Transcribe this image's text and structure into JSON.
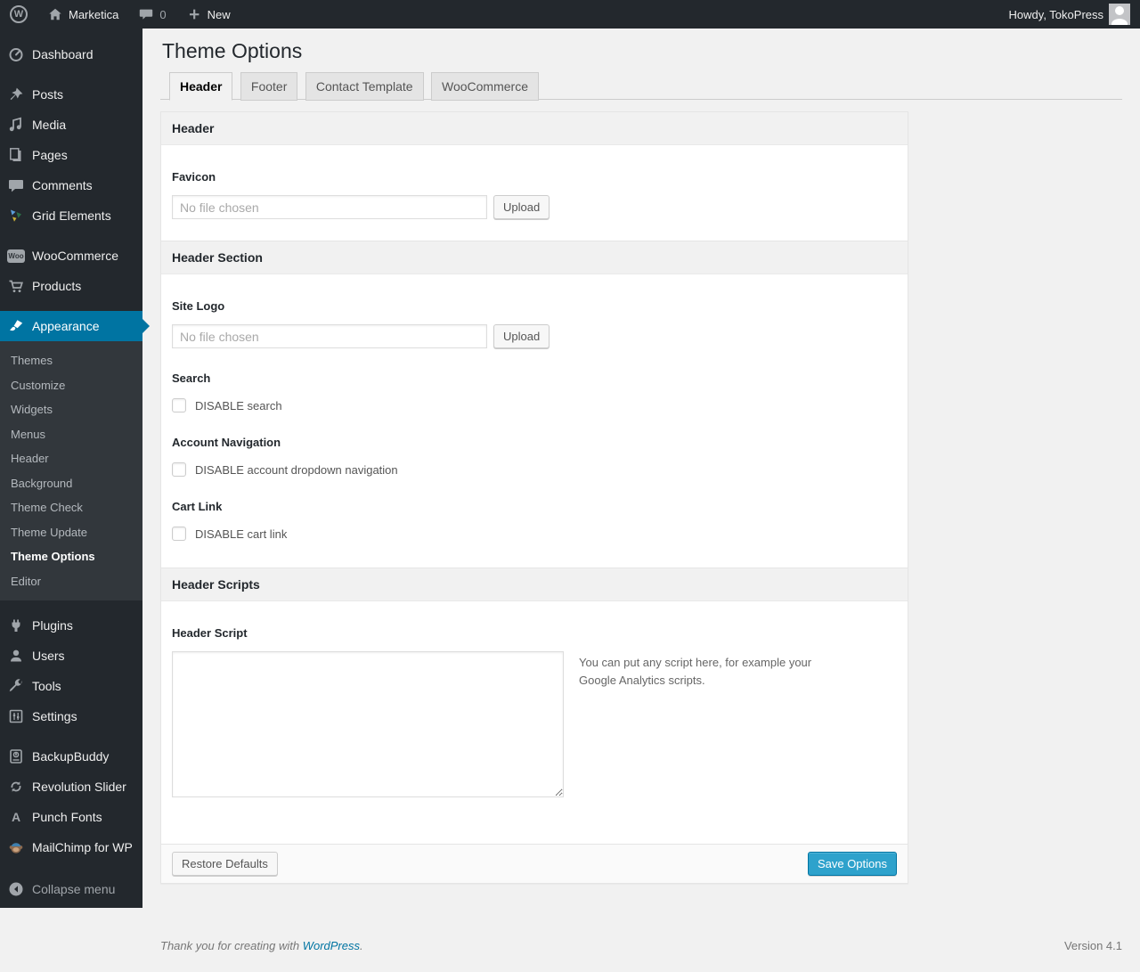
{
  "admin_bar": {
    "wp_logo_glyph": "W",
    "site_name": "Marketica",
    "comment_count": "0",
    "new_label": "New",
    "howdy_text": "Howdy, TokoPress"
  },
  "sidebar": {
    "items": [
      {
        "label": "Dashboard",
        "icon": "dashboard-icon"
      },
      {
        "label": "Posts",
        "icon": "pin-icon"
      },
      {
        "label": "Media",
        "icon": "media-icon"
      },
      {
        "label": "Pages",
        "icon": "pages-icon"
      },
      {
        "label": "Comments",
        "icon": "comments-icon"
      },
      {
        "label": "Grid Elements",
        "icon": "grid-elements-icon"
      },
      {
        "label": "WooCommerce",
        "icon": "woocommerce-badge-icon"
      },
      {
        "label": "Products",
        "icon": "cart-icon"
      },
      {
        "label": "Appearance",
        "icon": "brush-icon",
        "active": true
      },
      {
        "label": "Plugins",
        "icon": "plugin-icon"
      },
      {
        "label": "Users",
        "icon": "user-icon"
      },
      {
        "label": "Tools",
        "icon": "wrench-icon"
      },
      {
        "label": "Settings",
        "icon": "settings-icon"
      },
      {
        "label": "BackupBuddy",
        "icon": "backup-drive-icon"
      },
      {
        "label": "Revolution Slider",
        "icon": "rotate-arrows-icon"
      },
      {
        "label": "Punch Fonts",
        "icon": "letter-a-icon"
      },
      {
        "label": "MailChimp for WP",
        "icon": "mailchimp-monkey-icon"
      },
      {
        "label": "Collapse menu",
        "icon": "collapse-arrow-icon"
      }
    ],
    "woo_badge_text": "Woo",
    "punch_fonts_glyph": "A",
    "appearance_submenu": [
      "Themes",
      "Customize",
      "Widgets",
      "Menus",
      "Header",
      "Background",
      "Theme Check",
      "Theme Update",
      "Theme Options",
      "Editor"
    ],
    "active_item": "Appearance",
    "active_submenu_item": "Theme Options"
  },
  "main": {
    "title": "Theme Options",
    "tabs": [
      {
        "label": "Header",
        "active": true
      },
      {
        "label": "Footer",
        "active": false
      },
      {
        "label": "Contact Template",
        "active": false
      },
      {
        "label": "WooCommerce",
        "active": false
      }
    ],
    "panel": {
      "section_header": "Header",
      "favicon": {
        "label": "Favicon",
        "file_value": "No file chosen",
        "upload_label": "Upload"
      },
      "section_header_section": "Header Section",
      "site_logo": {
        "label": "Site Logo",
        "file_value": "No file chosen",
        "upload_label": "Upload"
      },
      "search": {
        "label": "Search",
        "checkbox_label": "DISABLE search",
        "checked": false
      },
      "account_nav": {
        "label": "Account Navigation",
        "checkbox_label": "DISABLE account dropdown navigation",
        "checked": false
      },
      "cart_link": {
        "label": "Cart Link",
        "checkbox_label": "DISABLE cart link",
        "checked": false
      },
      "section_header_scripts": "Header Scripts",
      "header_script": {
        "label": "Header Script",
        "value": "",
        "help_text": "You can put any script here, for example your Google Analytics scripts."
      },
      "restore_button": "Restore Defaults",
      "save_button": "Save Options"
    }
  },
  "page_footer": {
    "thanks_prefix": "Thank you for creating with ",
    "wordpress_link": "WordPress",
    "suffix": ".",
    "version": "Version 4.1"
  },
  "colors": {
    "admin_bar_bg": "#23282d",
    "submenu_bg": "#32373c",
    "accent_blue": "#0074a2",
    "primary_button": "#2ea2cc",
    "page_bg": "#f1f1f1",
    "section_bar_bg": "#f1f1f1"
  }
}
